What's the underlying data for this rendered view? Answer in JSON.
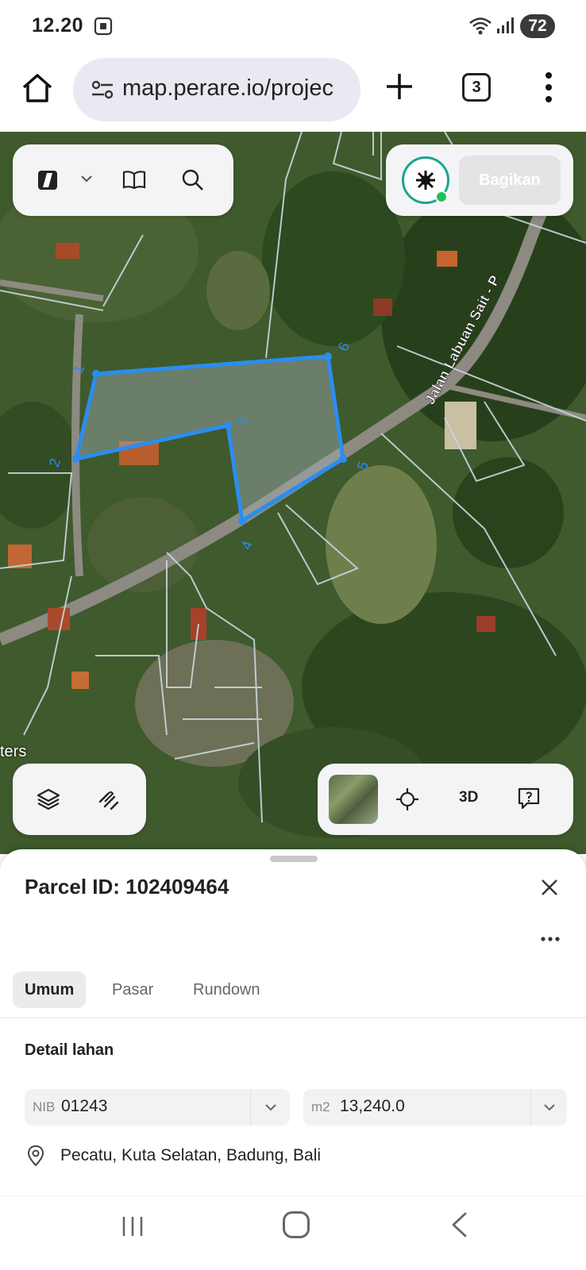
{
  "status_bar": {
    "time": "12.20",
    "battery": "72",
    "icons": [
      "screen-record-icon",
      "wifi-icon",
      "signal-icon",
      "battery-icon"
    ]
  },
  "browser": {
    "url": "map.perare.io/projec",
    "tab_count": "3",
    "icons": [
      "home-icon",
      "site-settings-icon",
      "new-tab-icon",
      "tabs-icon",
      "more-menu-icon"
    ]
  },
  "map": {
    "share_label": "Bagikan",
    "road_label": "Jalan Labuan Sait - P",
    "scale_text": "ters",
    "vertex_labels": [
      "1",
      "2",
      "3",
      "4",
      "5",
      "6"
    ],
    "three_d_label": "3D",
    "parcel_color": "#2a8df0",
    "top_left_icons": [
      "sidebar-logo-icon",
      "chevron-down-icon",
      "book-icon",
      "search-icon"
    ],
    "bottom_left_icons": [
      "layers-icon",
      "measure-icon"
    ],
    "bottom_right_icons": [
      "satellite-thumbnail",
      "locate-icon",
      "3d-icon",
      "feedback-icon"
    ]
  },
  "parcel": {
    "title": "Parcel ID: 102409464",
    "tabs": [
      "Umum",
      "Pasar",
      "Rundown"
    ],
    "active_tab": "Umum",
    "section_title": "Detail lahan",
    "nib_prefix": "NIB",
    "nib_value": "01243",
    "area_prefix": "m2",
    "area_value": "13,240.0",
    "location": "Pecatu, Kuta Selatan, Badung, Bali"
  },
  "nav_bar": {
    "icons": [
      "recents-icon",
      "home-nav-icon",
      "back-icon"
    ]
  }
}
